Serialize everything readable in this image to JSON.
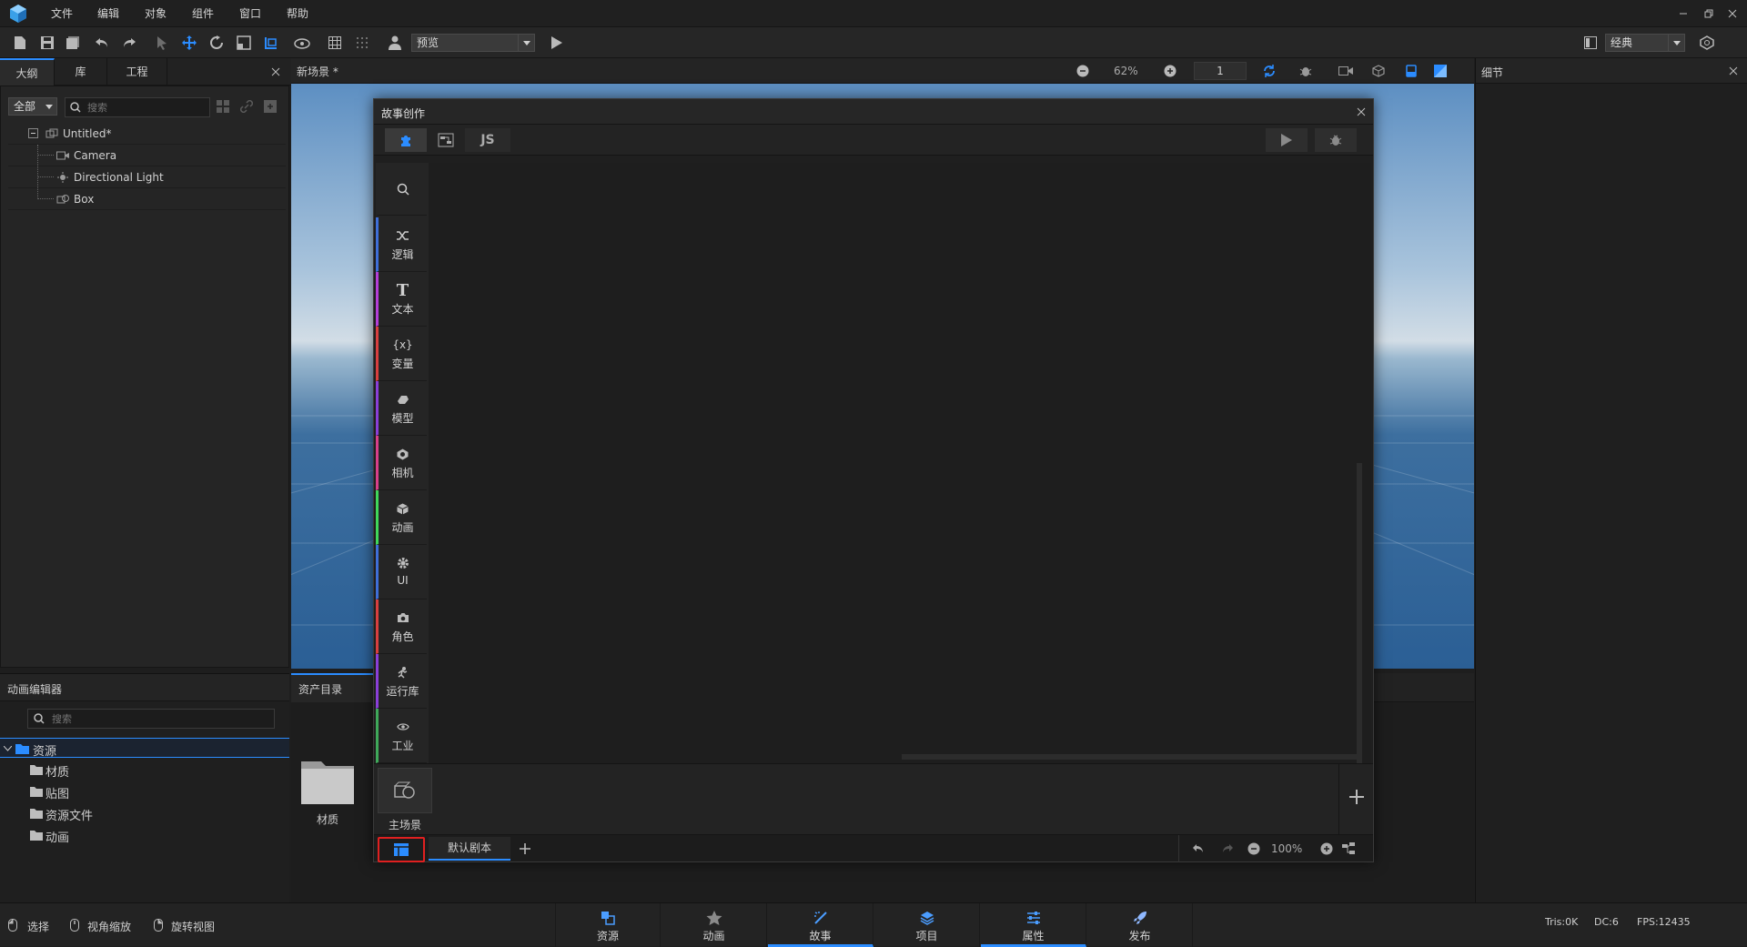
{
  "menu": [
    "文件",
    "编辑",
    "对象",
    "组件",
    "窗口",
    "帮助"
  ],
  "toolbar": {
    "preview_select": "预览",
    "layout_select": "经典"
  },
  "left_tabs": [
    "大纲",
    "库",
    "工程"
  ],
  "outline": {
    "filter": "全部",
    "search_placeholder": "搜索",
    "items": [
      "Untitled*",
      "Camera",
      "Directional Light",
      "Box"
    ]
  },
  "viewport": {
    "title": "新场景 *",
    "zoom": "62%",
    "frame": "1"
  },
  "details": {
    "title": "细节"
  },
  "anim_editor": {
    "title": "动画编辑器",
    "search_placeholder": "搜索",
    "root": "资源",
    "folders": [
      "材质",
      "贴图",
      "资源文件",
      "动画"
    ]
  },
  "assets": {
    "title": "资产目录",
    "item": "材质"
  },
  "story": {
    "title": "故事创作",
    "js_tab": "JS",
    "categories": [
      "逻辑",
      "文本",
      "变量",
      "模型",
      "相机",
      "动画",
      "UI",
      "角色",
      "运行库",
      "工业"
    ],
    "category_colors": [
      "#3f6fd8",
      "#b43fd8",
      "#d83f3f",
      "#8a3fd8",
      "#d83f8a",
      "#3fd85a",
      "#3f6fd8",
      "#d83f3f",
      "#8a3fd8",
      "#3fa85a"
    ],
    "scene_label": "主场景",
    "script_tab": "默认剧本",
    "zoom": "100%"
  },
  "status": {
    "hints": [
      "选择",
      "视角缩放",
      "旋转视图"
    ],
    "bottom_tabs": [
      "资源",
      "动画",
      "故事",
      "项目",
      "属性",
      "发布"
    ],
    "tris": "Tris:0K",
    "dc": "DC:6",
    "fps": "FPS:12435"
  },
  "colors": {
    "accent": "#2b8cff",
    "highlight": "#e02020"
  }
}
